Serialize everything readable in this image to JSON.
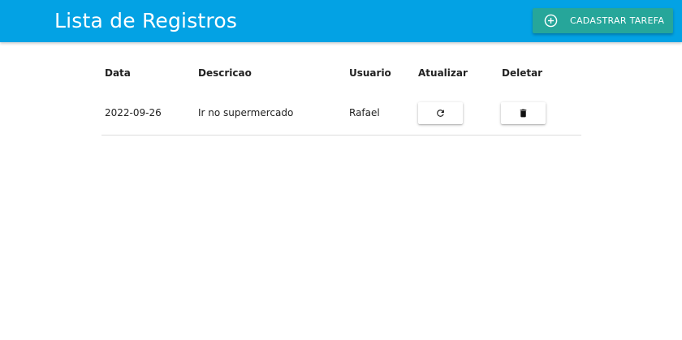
{
  "header": {
    "title": "Lista de Registros",
    "add_button_label": "CADASTRAR TAREFA",
    "add_button_icon": "plus-circle-icon",
    "bar_color": "#03a2e4",
    "button_color": "#26a69a"
  },
  "table": {
    "columns": [
      "Data",
      "Descricao",
      "Usuario",
      "Atualizar",
      "Deletar"
    ],
    "rows": [
      {
        "data": "2022-09-26",
        "descricao": "Ir no supermercado",
        "usuario": "Rafael",
        "update_icon": "refresh-icon",
        "delete_icon": "trash-icon"
      }
    ]
  }
}
